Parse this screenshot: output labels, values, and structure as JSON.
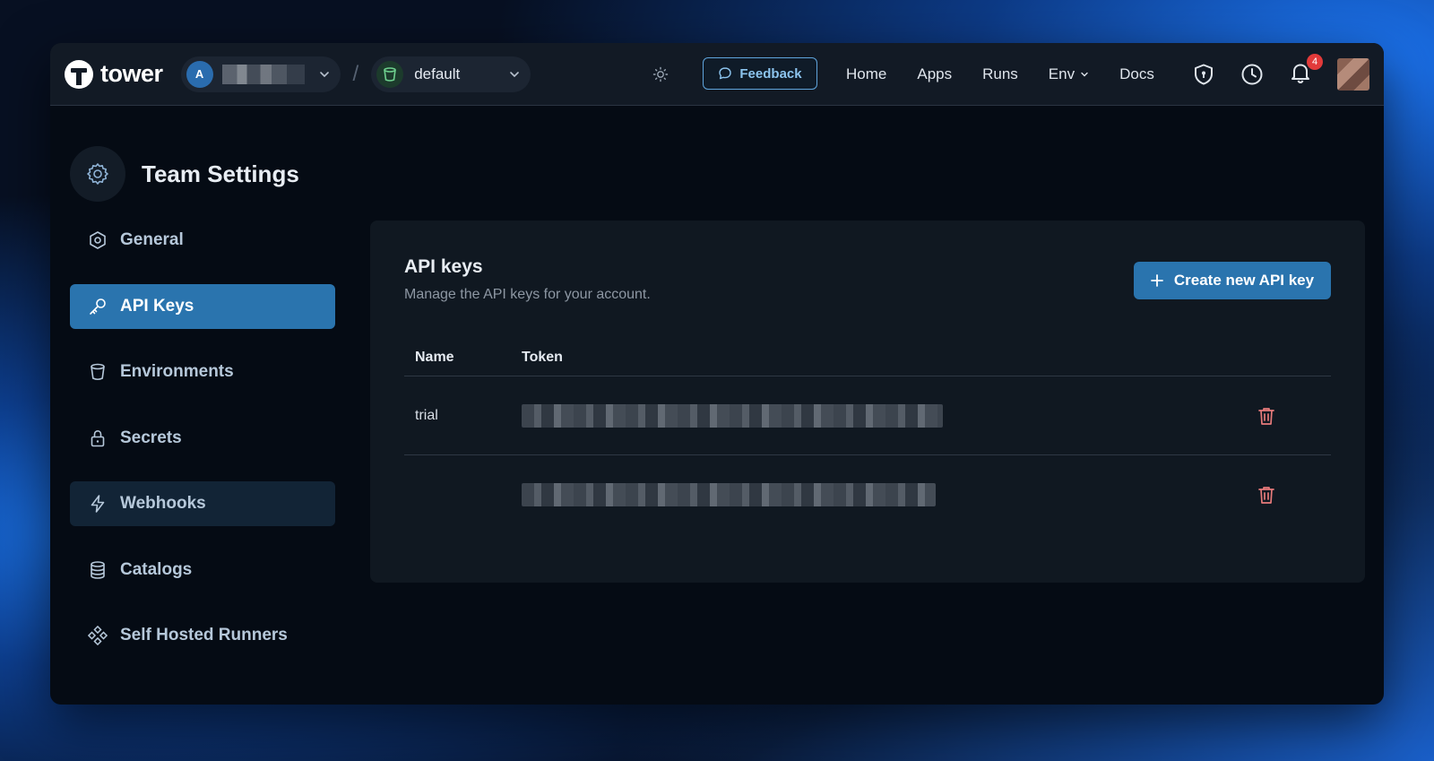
{
  "brand": {
    "name": "tower"
  },
  "team_selector": {
    "avatar_letter": "A"
  },
  "env_selector": {
    "label": "default"
  },
  "feedback": {
    "label": "Feedback"
  },
  "nav": {
    "home": "Home",
    "apps": "Apps",
    "runs": "Runs",
    "env": "Env",
    "docs": "Docs"
  },
  "notifications": {
    "count": "4"
  },
  "sidebar": {
    "title": "Team Settings",
    "items": [
      {
        "label": "General",
        "icon": "hexagon-icon"
      },
      {
        "label": "API Keys",
        "icon": "key-icon",
        "active": true
      },
      {
        "label": "Environments",
        "icon": "bucket-icon"
      },
      {
        "label": "Secrets",
        "icon": "lock-icon"
      },
      {
        "label": "Webhooks",
        "icon": "lightning-icon",
        "hover": true
      },
      {
        "label": "Catalogs",
        "icon": "database-icon"
      },
      {
        "label": "Self Hosted Runners",
        "icon": "diamond-nodes-icon"
      }
    ]
  },
  "panel": {
    "title": "API keys",
    "subtitle": "Manage the API keys for your account.",
    "create_label": "Create new API key",
    "columns": {
      "name": "Name",
      "token": "Token"
    },
    "rows": [
      {
        "name": "trial"
      },
      {
        "name": ""
      }
    ]
  },
  "colors": {
    "accent": "#2a74ae",
    "danger": "#e87b7b",
    "feedback": "#8cc4ee"
  }
}
